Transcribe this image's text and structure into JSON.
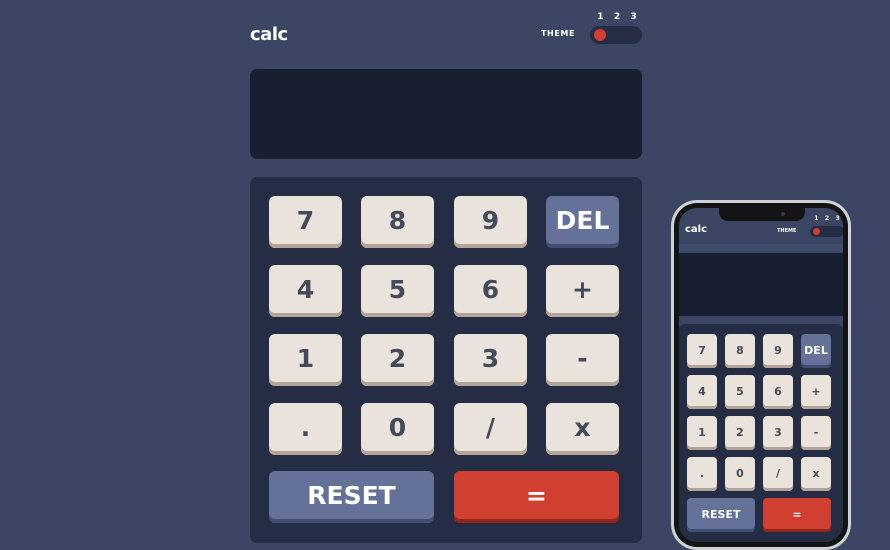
{
  "app": {
    "logo": "calc",
    "theme_label": "THEME",
    "theme_options": [
      "1",
      "2",
      "3"
    ],
    "selected_theme": "1",
    "display_value": ""
  },
  "keys": {
    "k7": "7",
    "k8": "8",
    "k9": "9",
    "del": "DEL",
    "k4": "4",
    "k5": "5",
    "k6": "6",
    "plus": "+",
    "k1": "1",
    "k2": "2",
    "k3": "3",
    "minus": "-",
    "dot": ".",
    "k0": "0",
    "divide": "/",
    "multiply": "x",
    "reset": "RESET",
    "equals": "="
  },
  "colors": {
    "background": "#3a4664",
    "keypad": "#242d44",
    "screen": "#181f33",
    "key": "#eae3dc",
    "key_accent": "#647198",
    "key_equals": "#d03f2f"
  }
}
